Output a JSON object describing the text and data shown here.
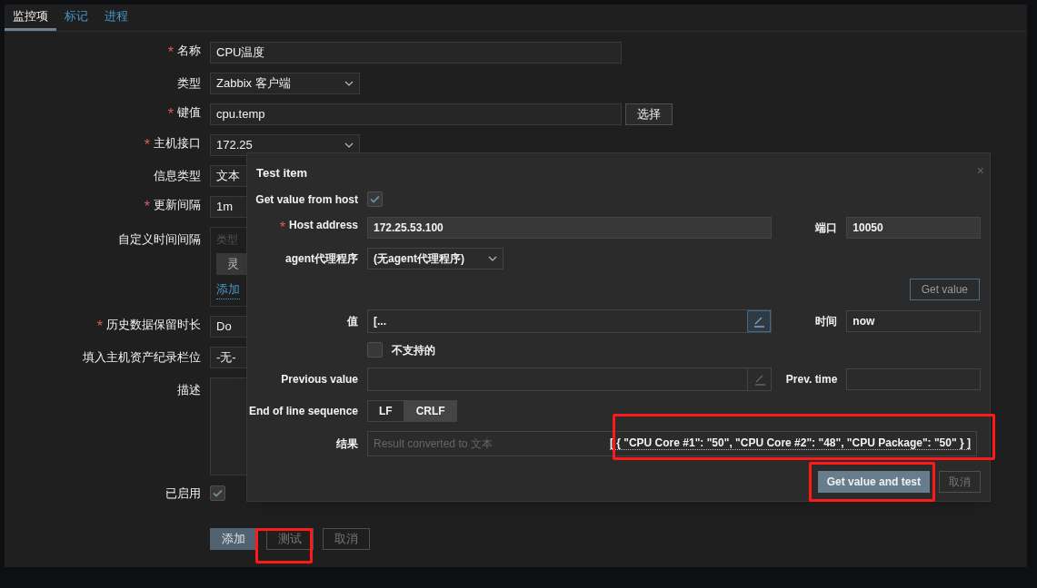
{
  "tabs": [
    {
      "label": "监控项",
      "selected": true
    },
    {
      "label": "标记",
      "selected": false
    },
    {
      "label": "进程",
      "selected": false
    }
  ],
  "form": {
    "fields": [
      {
        "kind": "input",
        "mark": "*",
        "label": "名称",
        "value": "CPU温度"
      },
      {
        "kind": "select",
        "label": "类型",
        "value": "Zabbix 客户端"
      },
      {
        "kind": "input-button",
        "mark": "*",
        "label": "键值",
        "value": "cpu.temp",
        "button": "选择"
      },
      {
        "kind": "select",
        "mark": "*",
        "label": "主机接口",
        "value": "172.25"
      },
      {
        "kind": "short",
        "label": "信息类型",
        "value": "文本"
      },
      {
        "kind": "short",
        "mark": "*",
        "label": "更新间隔",
        "value": "1m"
      },
      {
        "kind": "intervals",
        "label": "自定义时间间隔",
        "header": "类型",
        "button": "灵",
        "link": "添加"
      },
      {
        "kind": "short",
        "mark": "*",
        "label": "历史数据保留时长",
        "value": "Do"
      },
      {
        "kind": "short",
        "label": "填入主机资产纪录栏位",
        "value": "-无-"
      },
      {
        "kind": "textarea",
        "label": "描述"
      },
      {
        "kind": "checkbox",
        "label": "已启用",
        "checked": true
      }
    ],
    "buttons": [
      {
        "label": "添加",
        "kind": "primary"
      },
      {
        "label": "测试",
        "kind": "outline"
      },
      {
        "label": "取消",
        "kind": "outline"
      }
    ]
  },
  "dialog": {
    "title": "Test item",
    "close": "×",
    "get_value_from_host": {
      "label": "Get value from host",
      "checked": true
    },
    "host_address": {
      "mark": "*",
      "label": "Host address",
      "value": "172.25.53.100"
    },
    "port": {
      "label": "端口",
      "value": "10050"
    },
    "proxy": {
      "label": "agent代理程序",
      "value": "(无agent代理程序)"
    },
    "get_value_button": "Get value",
    "value": {
      "label": "值",
      "value": "[..."
    },
    "time": {
      "label": "时间",
      "value": "now"
    },
    "unsupported": {
      "label": "不支持的",
      "checked": false
    },
    "previous_value": {
      "label": "Previous value"
    },
    "prev_time": {
      "label": "Prev. time"
    },
    "eol": {
      "label": "End of line sequence",
      "options": [
        {
          "label": "LF",
          "selected": false
        },
        {
          "label": "CRLF",
          "selected": true
        }
      ]
    },
    "result": {
      "label": "结果",
      "placeholder": "Result converted to 文本",
      "value": "[ { \"CPU Core #1\": \"50\", \"CPU Core #2\": \"48\", \"CPU Package\": \"50\" } ]"
    },
    "buttons": [
      {
        "label": "Get value and test",
        "kind": "primary"
      },
      {
        "label": "取消",
        "kind": "outline"
      }
    ]
  }
}
